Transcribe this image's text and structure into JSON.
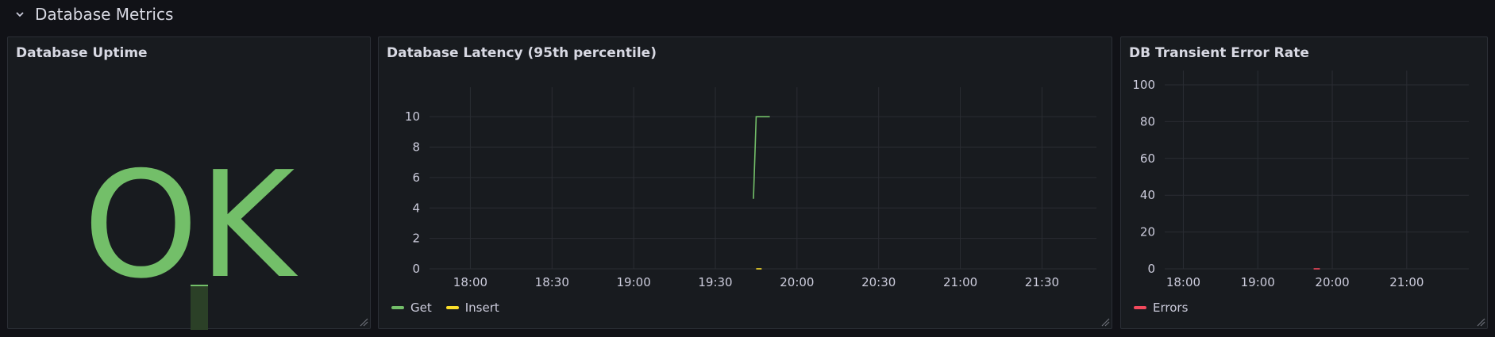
{
  "row": {
    "title": "Database Metrics"
  },
  "colors": {
    "green": "#73bf69",
    "yellow": "#fade2a",
    "red": "#f2495c"
  },
  "icons": {
    "collapse": "chevron-down-icon",
    "resize": "resize-handle-icon"
  },
  "panels": {
    "uptime": {
      "title": "Database Uptime",
      "value": "OK"
    },
    "latency": {
      "title": "Database Latency (95th percentile)",
      "legend": [
        {
          "label": "Get"
        },
        {
          "label": "Insert"
        }
      ]
    },
    "errors": {
      "title": "DB Transient Error Rate",
      "legend": [
        {
          "label": "Errors"
        }
      ]
    }
  },
  "chart_data": [
    {
      "type": "line",
      "title": "Database Latency (95th percentile)",
      "xlabel": "",
      "ylabel": "",
      "x_ticks": [
        "18:00",
        "18:30",
        "19:00",
        "19:30",
        "20:00",
        "20:30",
        "21:00",
        "21:30"
      ],
      "y_ticks": [
        "0",
        "2",
        "4",
        "6",
        "8",
        "10"
      ],
      "xlim": [
        "17:45",
        "21:50"
      ],
      "ylim": [
        0,
        11
      ],
      "grid": true,
      "legend_placement": "bottom-left",
      "series": [
        {
          "name": "Get",
          "color": "#73bf69",
          "points": [
            [
              "19:44",
              4.6
            ],
            [
              "19:45",
              10
            ],
            [
              "19:50",
              10
            ]
          ]
        },
        {
          "name": "Insert",
          "color": "#fade2a",
          "points": [
            [
              "19:45",
              0
            ],
            [
              "19:47",
              0
            ]
          ]
        }
      ]
    },
    {
      "type": "line",
      "title": "DB Transient Error Rate",
      "xlabel": "",
      "ylabel": "",
      "x_ticks": [
        "18:00",
        "19:00",
        "20:00",
        "21:00"
      ],
      "y_ticks": [
        "0",
        "20",
        "40",
        "60",
        "80",
        "100"
      ],
      "xlim": [
        "17:45",
        "21:50"
      ],
      "ylim": [
        0,
        100
      ],
      "grid": true,
      "legend_placement": "bottom-left",
      "series": [
        {
          "name": "Errors",
          "color": "#f2495c",
          "points": [
            [
              "19:45",
              0
            ],
            [
              "19:50",
              0
            ]
          ]
        }
      ]
    }
  ]
}
